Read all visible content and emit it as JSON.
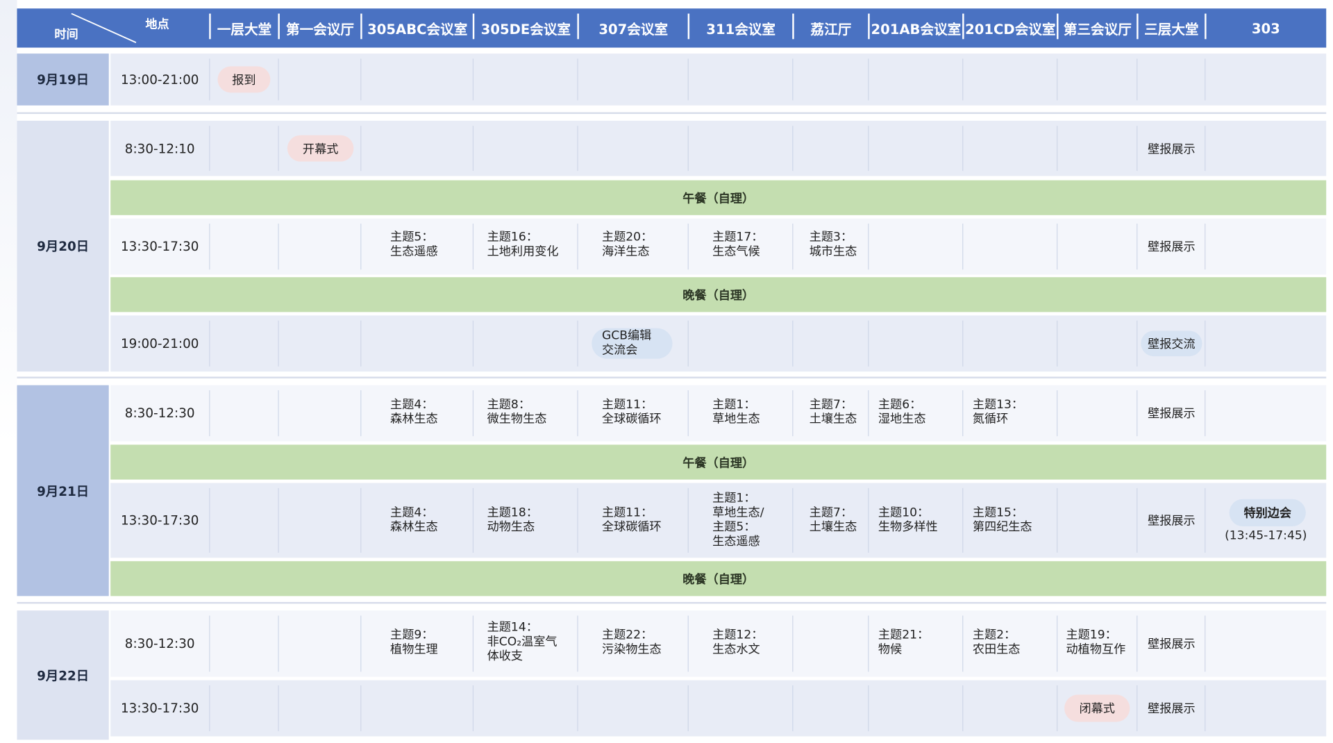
{
  "header": {
    "time_label": "时间",
    "place_label": "地点",
    "columns": [
      "一层大堂",
      "第一会议厅",
      "305ABC会议室",
      "305DE会议室",
      "307会议室",
      "311会议室",
      "荔江厅",
      "201AB会议室",
      "201CD会议室",
      "第三会议厅",
      "三层大堂",
      "303"
    ]
  },
  "days": [
    {
      "date": "9月19日",
      "slots": [
        {
          "time": "13:00-21:00"
        }
      ]
    },
    {
      "date": "9月20日",
      "slots": [
        {
          "time": "8:30-12:10"
        },
        {
          "time": "13:30-17:30"
        },
        {
          "time": "19:00-21:00"
        }
      ]
    },
    {
      "date": "9月21日",
      "slots": [
        {
          "time": "8:30-12:30"
        },
        {
          "time": "13:30-17:30"
        }
      ]
    },
    {
      "date": "9月22日",
      "slots": [
        {
          "time": "8:30-12:30"
        },
        {
          "time": "13:30-17:30"
        }
      ]
    }
  ],
  "meals": {
    "lunch": "午餐（自理）",
    "dinner": "晚餐（自理）"
  },
  "events": {
    "registration": "报到",
    "opening": "开幕式",
    "closing": "闭幕式",
    "poster_show": "壁报展示",
    "poster_exchange": "壁报交流",
    "gcb_l1": "GCB编辑",
    "gcb_l2": "交流会",
    "special_l1": "特别边会",
    "special_l2": "(13:45-17:45)"
  },
  "sessions": {
    "d20pm": [
      [
        "主题5：",
        "生态遥感"
      ],
      [
        "主题16：",
        "土地利用变化"
      ],
      [
        "主题20：",
        "海洋生态"
      ],
      [
        "主题17：",
        "生态气候"
      ],
      [
        "主题3：",
        "城市生态"
      ]
    ],
    "d21am": [
      [
        "主题4：",
        "森林生态"
      ],
      [
        "主题8：",
        "微生物生态"
      ],
      [
        "主题11：",
        "全球碳循环"
      ],
      [
        "主题1：",
        "草地生态"
      ],
      [
        "主题7：",
        "土壤生态"
      ],
      [
        "主题6：",
        "湿地生态"
      ],
      [
        "主题13：",
        "氮循环"
      ]
    ],
    "d21pm": [
      [
        "主题4：",
        "森林生态"
      ],
      [
        "主题18：",
        "动物生态"
      ],
      [
        "主题11：",
        "全球碳循环"
      ],
      [
        "主题1：",
        "草地生态/",
        "主题5：",
        "生态遥感"
      ],
      [
        "主题7：",
        "土壤生态"
      ],
      [
        "主题10：",
        "生物多样性"
      ],
      [
        "主题15：",
        "第四纪生态"
      ]
    ],
    "d22am": [
      [
        "主题9：",
        "植物生理"
      ],
      [
        "主题14：",
        "非CO₂温室气",
        "体收支"
      ],
      [
        "主题22：",
        "污染物生态"
      ],
      [
        "主题12：",
        "生态水文"
      ],
      [
        "主题21：",
        "物候"
      ],
      [
        "主题2：",
        "农田生态"
      ],
      [
        "主题19：",
        "动植物互作"
      ]
    ]
  },
  "colors": {
    "header": "#4a72c2",
    "date": "#b2c2e3",
    "meal": "#c4deb0",
    "pill_pink": "#f5dede",
    "pill_blue": "#d7e3f3"
  }
}
